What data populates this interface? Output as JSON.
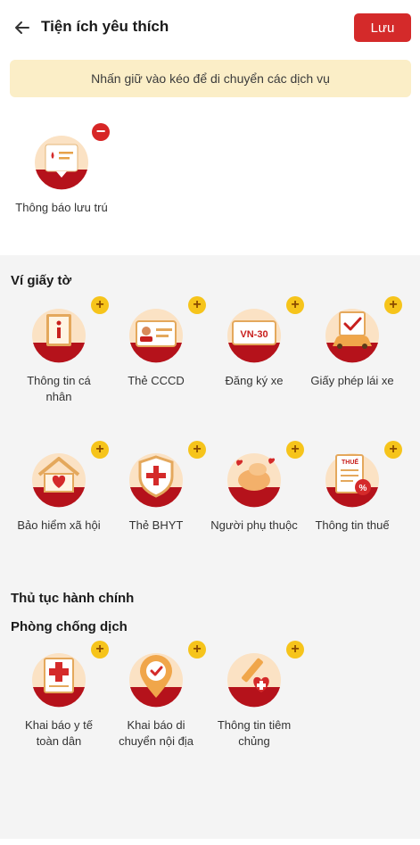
{
  "header": {
    "title": "Tiện ích yêu thích",
    "save_label": "Lưu"
  },
  "hint": "Nhấn giữ vào kéo để di chuyển các dịch vụ",
  "favorites": [
    {
      "label": "Thông báo lưu trú",
      "icon": "residence-notice-icon"
    }
  ],
  "sections": {
    "wallet": {
      "title": "Ví giấy tờ",
      "items": [
        {
          "label": "Thông tin cá nhân",
          "icon": "personal-info-icon"
        },
        {
          "label": "Thẻ CCCD",
          "icon": "id-card-icon"
        },
        {
          "label": "Đăng ký xe",
          "icon": "vehicle-registration-icon",
          "plate": "VN-30"
        },
        {
          "label": "Giấy phép lái xe",
          "icon": "driver-license-icon"
        },
        {
          "label": "Bảo hiểm xã hội",
          "icon": "social-insurance-icon"
        },
        {
          "label": "Thẻ BHYT",
          "icon": "health-insurance-icon"
        },
        {
          "label": "Người phụ thuộc",
          "icon": "dependents-icon"
        },
        {
          "label": "Thông tin thuế",
          "icon": "tax-info-icon",
          "tag": "THUẾ"
        }
      ]
    },
    "admin": {
      "title": "Thủ tục hành chính"
    },
    "epidemic": {
      "title": "Phòng chống dịch",
      "items": [
        {
          "label": "Khai báo y tế toàn dân",
          "icon": "health-declaration-icon"
        },
        {
          "label": "Khai báo di chuyển nội địa",
          "icon": "domestic-travel-icon"
        },
        {
          "label": "Thông tin tiêm chủng",
          "icon": "vaccination-icon"
        }
      ]
    }
  },
  "colors": {
    "accent": "#d42a2a",
    "hint_bg": "#fbeec7",
    "badge_add": "#f6c41b",
    "badge_remove": "#d72626",
    "icon_bg": "#fbe2c4"
  },
  "badges": {
    "add": "+",
    "remove": "−"
  }
}
